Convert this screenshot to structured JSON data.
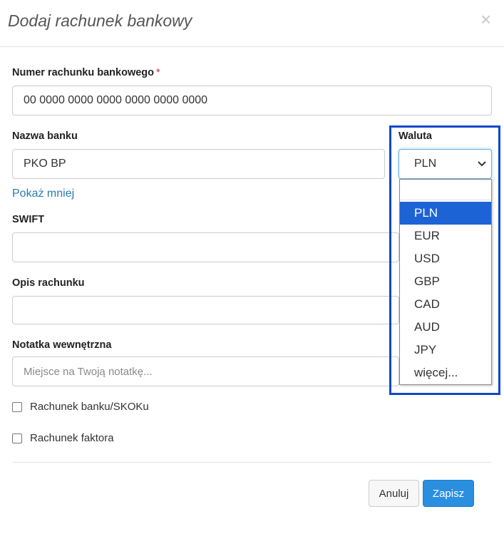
{
  "modal": {
    "title": "Dodaj rachunek bankowy",
    "close": "×"
  },
  "form": {
    "account_number": {
      "label": "Numer rachunku bankowego",
      "required_mark": "*",
      "value": "00 0000 0000 0000 0000 0000 0000"
    },
    "bank_name": {
      "label": "Nazwa banku",
      "value": "PKO BP"
    },
    "toggle_link": "Pokaż mniej",
    "swift": {
      "label": "SWIFT",
      "value": ""
    },
    "description": {
      "label": "Opis rachunku",
      "value": ""
    },
    "internal_note": {
      "label": "Notatka wewnętrzna",
      "placeholder": "Miejsce na Twoją notatkę..."
    },
    "currency": {
      "label": "Waluta",
      "value": "PLN",
      "options": [
        "PLN",
        "EUR",
        "USD",
        "GBP",
        "CAD",
        "AUD",
        "JPY",
        "więcej..."
      ],
      "selected_index": 0
    },
    "checkboxes": [
      {
        "label": "Rachunek banku/SKOKu",
        "checked": false
      },
      {
        "label": "Rachunek faktora",
        "checked": false
      }
    ]
  },
  "footer": {
    "cancel_label": "Anuluj",
    "save_label": "Zapisz"
  },
  "colors": {
    "accent": "#2b8fe0",
    "selected_option": "#1e63d6",
    "highlight_frame": "#1046c9",
    "required": "#c9302c",
    "link": "#2a7ab0"
  }
}
